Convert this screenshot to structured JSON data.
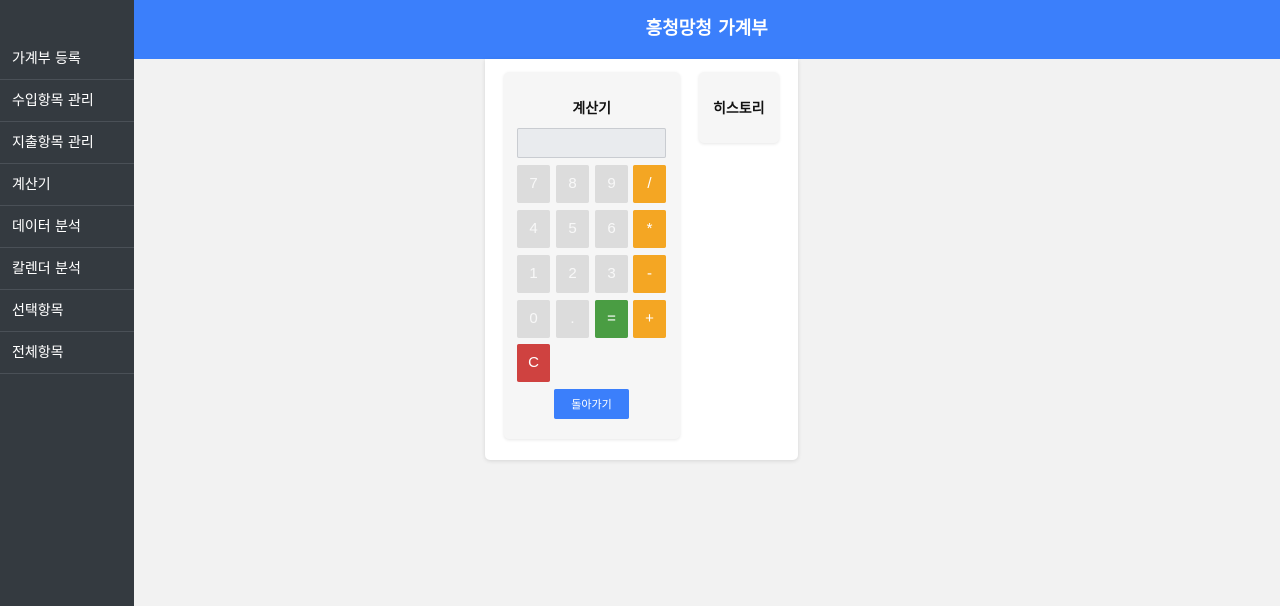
{
  "sidebar": {
    "items": [
      {
        "label": "가계부 등록"
      },
      {
        "label": "수입항목 관리"
      },
      {
        "label": "지출항목 관리"
      },
      {
        "label": "계산기"
      },
      {
        "label": "데이터 분석"
      },
      {
        "label": "칼렌더 분석"
      },
      {
        "label": "선택항목"
      },
      {
        "label": "전체항목"
      }
    ]
  },
  "header": {
    "title": "흥청망청 가계부"
  },
  "calculator": {
    "title": "계산기",
    "display_value": "",
    "keys": {
      "k7": "7",
      "k8": "8",
      "k9": "9",
      "div": "/",
      "k4": "4",
      "k5": "5",
      "k6": "6",
      "mul": "*",
      "k1": "1",
      "k2": "2",
      "k3": "3",
      "sub": "-",
      "k0": "0",
      "dot": ".",
      "eq": "=",
      "add": "+",
      "clear": "C"
    },
    "back_label": "돌아가기"
  },
  "history": {
    "title": "히스토리"
  },
  "colors": {
    "header": "#3b7ffb",
    "sidebar": "#343a40",
    "operator": "#f4a623",
    "equals": "#4a9d43",
    "clear": "#cf4240"
  }
}
